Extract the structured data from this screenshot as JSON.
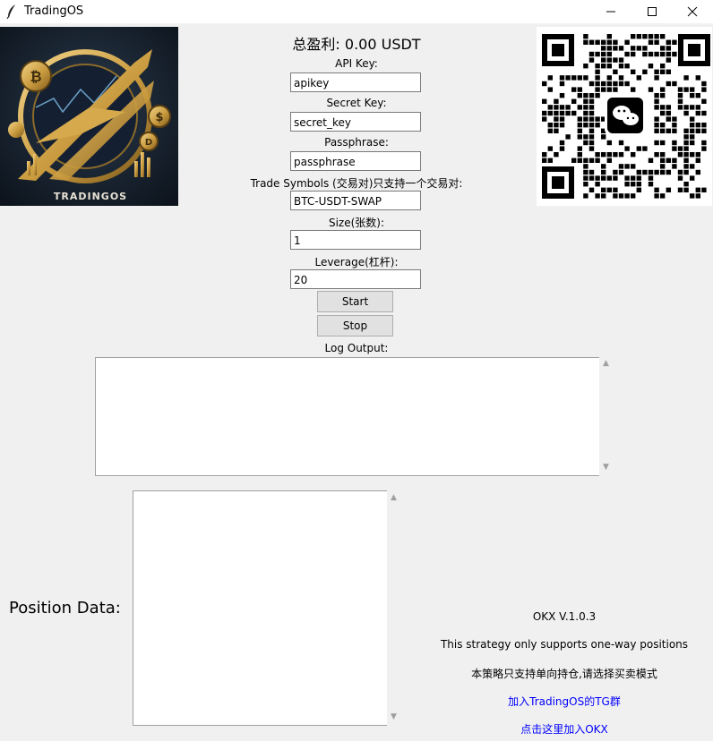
{
  "window": {
    "title": "TradingOS",
    "icon": "feather-icon",
    "controls": [
      "minimize-icon",
      "maximize-icon",
      "close-icon"
    ]
  },
  "logo": {
    "text": "TRADINGOS"
  },
  "qr": {
    "icon": "wechat-icon"
  },
  "total_profit": "总盈利: 0.00 USDT",
  "form": {
    "api_key_label": "API Key:",
    "api_key_value": "apikey",
    "secret_key_label": "Secret Key:",
    "secret_key_value": "secret_key",
    "passphrase_label": "Passphrase:",
    "passphrase_value": "passphrase",
    "symbols_label": "Trade Symbols (交易对)只支持一个交易对:",
    "symbols_value": "BTC-USDT-SWAP",
    "size_label": "Size(张数):",
    "size_value": "1",
    "leverage_label": "Leverage(杠杆):",
    "leverage_value": "20",
    "start_label": "Start",
    "stop_label": "Stop"
  },
  "log": {
    "label": "Log Output:",
    "content": ""
  },
  "position": {
    "label": "Position Data:",
    "content": ""
  },
  "info": {
    "version": "OKX V.1.0.3",
    "note_en": "This strategy only supports one-way positions",
    "note_cn": "本策略只支持单向持仓,请选择买卖模式",
    "tg_link": "加入TradingOS的TG群",
    "okx_link": "点击这里加入OKX"
  },
  "colors": {
    "link": "#0000ff",
    "background": "#f0f0f0"
  }
}
